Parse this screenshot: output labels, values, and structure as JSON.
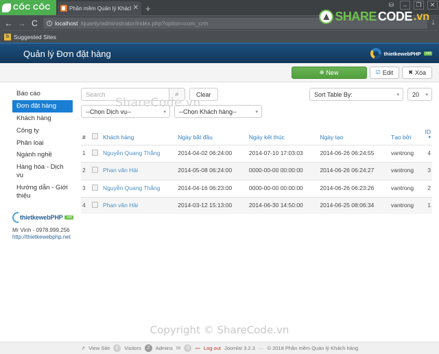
{
  "browser": {
    "brand": "CỐC CỐC",
    "tab_title": "Phần mềm Quản lý Khách",
    "tab_close": "✕",
    "new_tab": "+",
    "nav_back": "←",
    "nav_forward": "→",
    "nav_reload": "C",
    "url_info": "i",
    "url_host": "localhost",
    "url_path": "/quanly/administrator/index.php?option=com_crm",
    "download_icon": "⤓",
    "win_user": "user-icon",
    "win_minimize": "–",
    "win_restore": "❐",
    "win_close": "✕",
    "bookmark_icon": "b",
    "bookmark_label": "Suggested Sites"
  },
  "app_header": {
    "title": "Quản lý Đơn đặt hàng",
    "logo_text": "thietkewebPHP",
    "logo_badge": ".net"
  },
  "toolbar": {
    "new_label": "New",
    "new_icon": "⊕",
    "edit_label": "Edit",
    "edit_icon": "☑",
    "delete_label": "Xóa",
    "delete_icon": "✖"
  },
  "sidebar": {
    "items": [
      {
        "label": "Báo cáo",
        "active": false
      },
      {
        "label": "Đơn đặt hàng",
        "active": true
      },
      {
        "label": "Khách hàng",
        "active": false
      },
      {
        "label": "Công ty",
        "active": false
      },
      {
        "label": "Phân loại",
        "active": false
      },
      {
        "label": "Ngành nghề",
        "active": false
      },
      {
        "label": "Hàng hóa - Dịch vụ",
        "active": false
      },
      {
        "label": "Hướng dẫn - Giới thiệu",
        "active": false
      }
    ],
    "brand_name": "thietkewebPHP",
    "brand_badge": ".net",
    "contact": "Mr Vinh - 0978.999.256",
    "website": "http://thietkewebphp.net"
  },
  "filters": {
    "search_placeholder": "Search",
    "search_value": "",
    "search_icon": "⌕",
    "clear_label": "Clear",
    "sort_label": "Sort Table By:",
    "limit_label": "20",
    "service_label": "--Chọn Dịch vụ--",
    "customer_label": "--Chọn Khách hàng--"
  },
  "table": {
    "headers": {
      "hash": "#",
      "select_all": "",
      "customer": "Khách hàng",
      "start_date": "Ngày bắt đầu",
      "end_date": "Ngày kết thúc",
      "created_date": "Ngày tạo",
      "created_by": "Tạo bởi",
      "id": "ID",
      "id_sort_icon": "▾"
    },
    "rows": [
      {
        "index": "1",
        "customer": "Nguyễn Quang Thắng",
        "start_date": "2014-04-02 06:24:00",
        "end_date": "2014-07-10 17:03:03",
        "created_date": "2014-06-26 06:24:55",
        "created_by": "vantrong",
        "id": "4"
      },
      {
        "index": "2",
        "customer": "Phan văn Hải",
        "start_date": "2014-05-08 06:24:00",
        "end_date": "0000-00-00 00:00:00",
        "created_date": "2014-06-26 06:24:27",
        "created_by": "vantrong",
        "id": "3"
      },
      {
        "index": "3",
        "customer": "Nguyễn Quang Thắng",
        "start_date": "2014-04-16 06:23:00",
        "end_date": "0000-00-00 00:00:00",
        "created_date": "2014-06-26 06:23:26",
        "created_by": "vantrong",
        "id": "2"
      },
      {
        "index": "4",
        "customer": "Phan văn Hải",
        "start_date": "2014-03-12 15:13:00",
        "end_date": "2014-06-30 14:50:00",
        "created_date": "2014-06-25 08:06:34",
        "created_by": "vantrong",
        "id": "1"
      }
    ]
  },
  "footer": {
    "view_site_icon": "↗",
    "view_site": "View Site",
    "visitors_count": "0",
    "visitors_label": "Visitors",
    "admins_count": "2",
    "admins_label": "Admins",
    "mail_icon": "✉",
    "mail_count": "0",
    "logout_dash": "—",
    "logout_label": "Log out",
    "joomla_version": "Joomla! 3.2.3",
    "separator": "—",
    "copyright": "© 2018 Phần mềm Quản lý Khách hàng"
  },
  "watermarks": {
    "toolbar": "ShareCode.vn",
    "center": "Copyright © ShareCode.vn",
    "brand_share": "SHARE",
    "brand_code": "CODE",
    "brand_tld": ".vn"
  }
}
